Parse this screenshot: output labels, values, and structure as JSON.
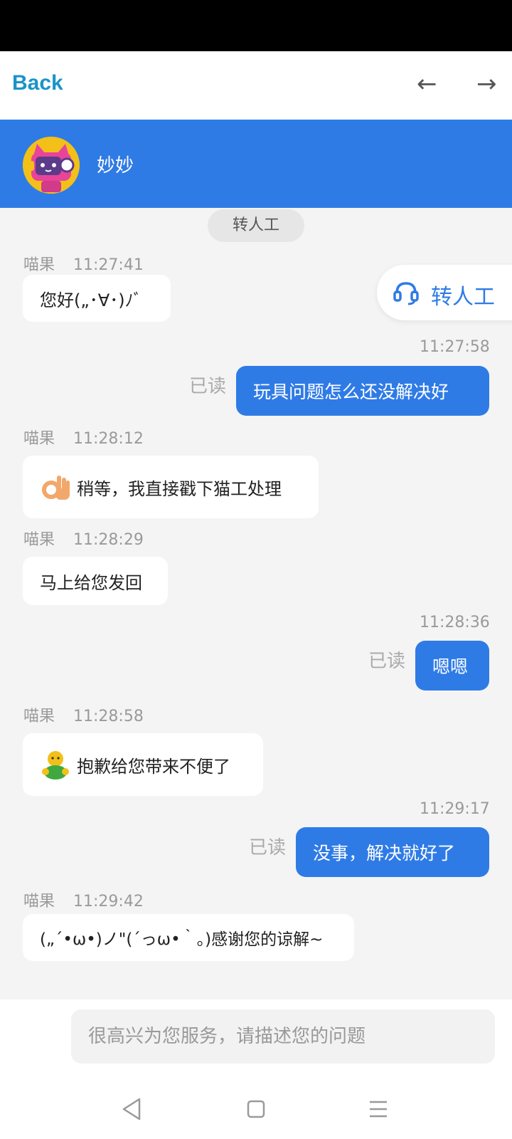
{
  "topbar": {
    "back_label": "Back",
    "arrow_back": "←",
    "arrow_forward": "→"
  },
  "header": {
    "contact_name": "妙妙"
  },
  "chat": {
    "transfer_chip": "转人工",
    "float_transfer_label": "转人工",
    "messages": [
      {
        "sender": "喵果",
        "time": "11:27:41",
        "text": "您好(„･∀･)ﾉﾞ"
      },
      {
        "time": "11:27:58",
        "status": "已读",
        "text": "玩具问题怎么还没解决好"
      },
      {
        "sender": "喵果",
        "time": "11:28:12",
        "icon": "ok-hand-emoji-icon",
        "text": "稍等，我直接戳下猫工处理"
      },
      {
        "sender": "喵果",
        "time": "11:28:29",
        "text": "马上给您发回"
      },
      {
        "time": "11:28:36",
        "status": "已读",
        "text": "嗯嗯"
      },
      {
        "sender": "喵果",
        "time": "11:28:58",
        "icon": "green-figure-emoji-icon",
        "text": "抱歉给您带来不便了"
      },
      {
        "time": "11:29:17",
        "status": "已读",
        "text": "没事，解决就好了"
      },
      {
        "sender": "喵果",
        "time": "11:29:42",
        "text": "(„´•ω•)ノ\"(´っω•｀。)感谢您的谅解~"
      }
    ]
  },
  "input": {
    "placeholder": "很高兴为您服务，请描述您的问题"
  },
  "colors": {
    "accent": "#2f7be6",
    "back_link": "#1a94c8",
    "chat_bg": "#f4f4f4"
  }
}
